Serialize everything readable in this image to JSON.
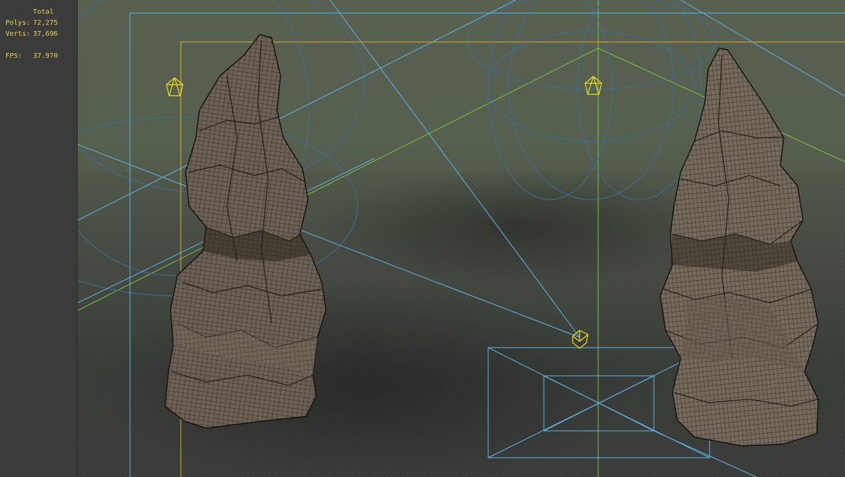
{
  "stats": {
    "header": "Total",
    "polys_label": "Polys:",
    "polys_value": "72,275",
    "verts_label": "Verts:",
    "verts_value": "37,696",
    "fps_label": "FPS:",
    "fps_value": "37.970"
  },
  "colors": {
    "panel_bg": "#3b3b3b",
    "stats_text": "#e8d34a",
    "safe_frame_outer": "#5ab8e0",
    "safe_frame_inner": "#e0b030",
    "grid_axis": "#7ccc3c",
    "camera_lines": "#62b8ee",
    "light_gizmo": "#f2e21c",
    "mesh_fill": "#6b5f53",
    "mesh_wire": "#1c1814"
  },
  "icons": {
    "light_left": "light-icon",
    "light_center": "light-icon",
    "camera_target": "camera-target-icon"
  }
}
